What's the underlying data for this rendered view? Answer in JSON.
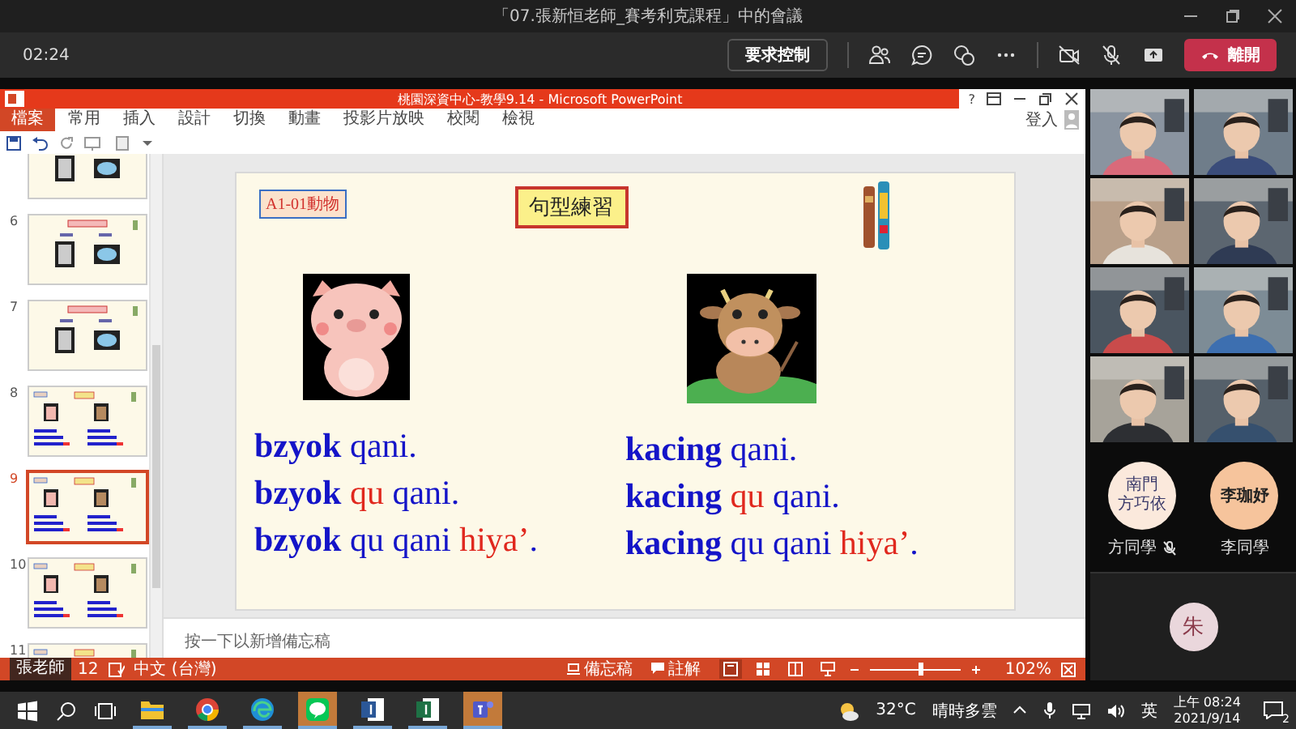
{
  "window": {
    "title": "「07.張新恒老師_賽考利克課程」中的會議"
  },
  "meeting_toolbar": {
    "timer": "02:24",
    "request_control": "要求控制",
    "leave": "離開"
  },
  "powerpoint": {
    "title": "桃園深資中心-教學9.14 - Microsoft PowerPoint",
    "help": "?",
    "sign_in": "登入",
    "tabs": [
      {
        "label": "檔案",
        "selected": true
      },
      {
        "label": "常用",
        "selected": false
      },
      {
        "label": "插入",
        "selected": false
      },
      {
        "label": "設計",
        "selected": false
      },
      {
        "label": "切換",
        "selected": false
      },
      {
        "label": "動畫",
        "selected": false
      },
      {
        "label": "投影片放映",
        "selected": false
      },
      {
        "label": "校閱",
        "selected": false
      },
      {
        "label": "檢視",
        "selected": false
      }
    ],
    "thumbnails": [
      {
        "kind": "images",
        "selected": false
      },
      {
        "number": "6",
        "kind": "images",
        "selected": false
      },
      {
        "number": "7",
        "kind": "images",
        "selected": false
      },
      {
        "number": "8",
        "kind": "sentences",
        "selected": false
      },
      {
        "number": "9",
        "kind": "sentences",
        "selected": true
      },
      {
        "number": "10",
        "kind": "sentences",
        "selected": false
      },
      {
        "number": "11",
        "kind": "sentences",
        "selected": false
      }
    ],
    "slide": {
      "tag": "A1-01動物",
      "title": "句型練習",
      "columns": [
        {
          "kind": "pig",
          "lines": [
            [
              {
                "text": "bzyok",
                "kind": "subject"
              },
              {
                "text": " qani.",
                "kind": "plain"
              }
            ],
            [
              {
                "text": "bzyok",
                "kind": "subject"
              },
              {
                "text": " qu",
                "kind": "highlight"
              },
              {
                "text": " qani.",
                "kind": "plain"
              }
            ],
            [
              {
                "text": "bzyok",
                "kind": "subject"
              },
              {
                "text": " qu qani ",
                "kind": "plain"
              },
              {
                "text": "hiya’",
                "kind": "highlight"
              },
              {
                "text": ".",
                "kind": "plain"
              }
            ]
          ]
        },
        {
          "kind": "cow",
          "lines": [
            [
              {
                "text": "kacing",
                "kind": "subject"
              },
              {
                "text": " qani.",
                "kind": "plain"
              }
            ],
            [
              {
                "text": "kacing",
                "kind": "subject"
              },
              {
                "text": " qu",
                "kind": "highlight"
              },
              {
                "text": " qani.",
                "kind": "plain"
              }
            ],
            [
              {
                "text": "kacing",
                "kind": "subject"
              },
              {
                "text": " qu qani ",
                "kind": "plain"
              },
              {
                "text": "hiya’",
                "kind": "highlight"
              },
              {
                "text": ".",
                "kind": "plain"
              }
            ]
          ]
        }
      ]
    },
    "notes_placeholder": "按一下以新增備忘稿",
    "status_bar": {
      "slide_count": "12",
      "language": "中文 (台灣)",
      "notes": "備忘稿",
      "comments": "註解",
      "zoom": "102%",
      "zoom_slider": {
        "level": 0.55
      }
    }
  },
  "presenter": "張老師",
  "participants": {
    "avatars": [
      {
        "lines": [
          "南門",
          "方巧依"
        ],
        "name": "方同學",
        "muted": true,
        "color": "#fbe9dc"
      },
      {
        "lines": [
          "李珈妤"
        ],
        "name": "李同學",
        "muted": false,
        "color": "#f6c49c"
      }
    ],
    "overflow": {
      "initial": "朱",
      "color": "#ead7dc"
    }
  },
  "taskbar": {
    "apps": [
      {
        "kind": "explorer",
        "flashing": false
      },
      {
        "kind": "chrome",
        "flashing": false
      },
      {
        "kind": "edge",
        "flashing": false
      },
      {
        "kind": "line",
        "flashing": true
      },
      {
        "kind": "word",
        "flashing": false
      },
      {
        "kind": "excel",
        "flashing": false
      },
      {
        "kind": "teams",
        "flashing": true
      }
    ],
    "weather": {
      "temperature": "32°C",
      "condition": "晴時多雲"
    },
    "input_language": "英",
    "time": "上午 08:24",
    "date": "2021/9/14",
    "notifications": "2"
  }
}
